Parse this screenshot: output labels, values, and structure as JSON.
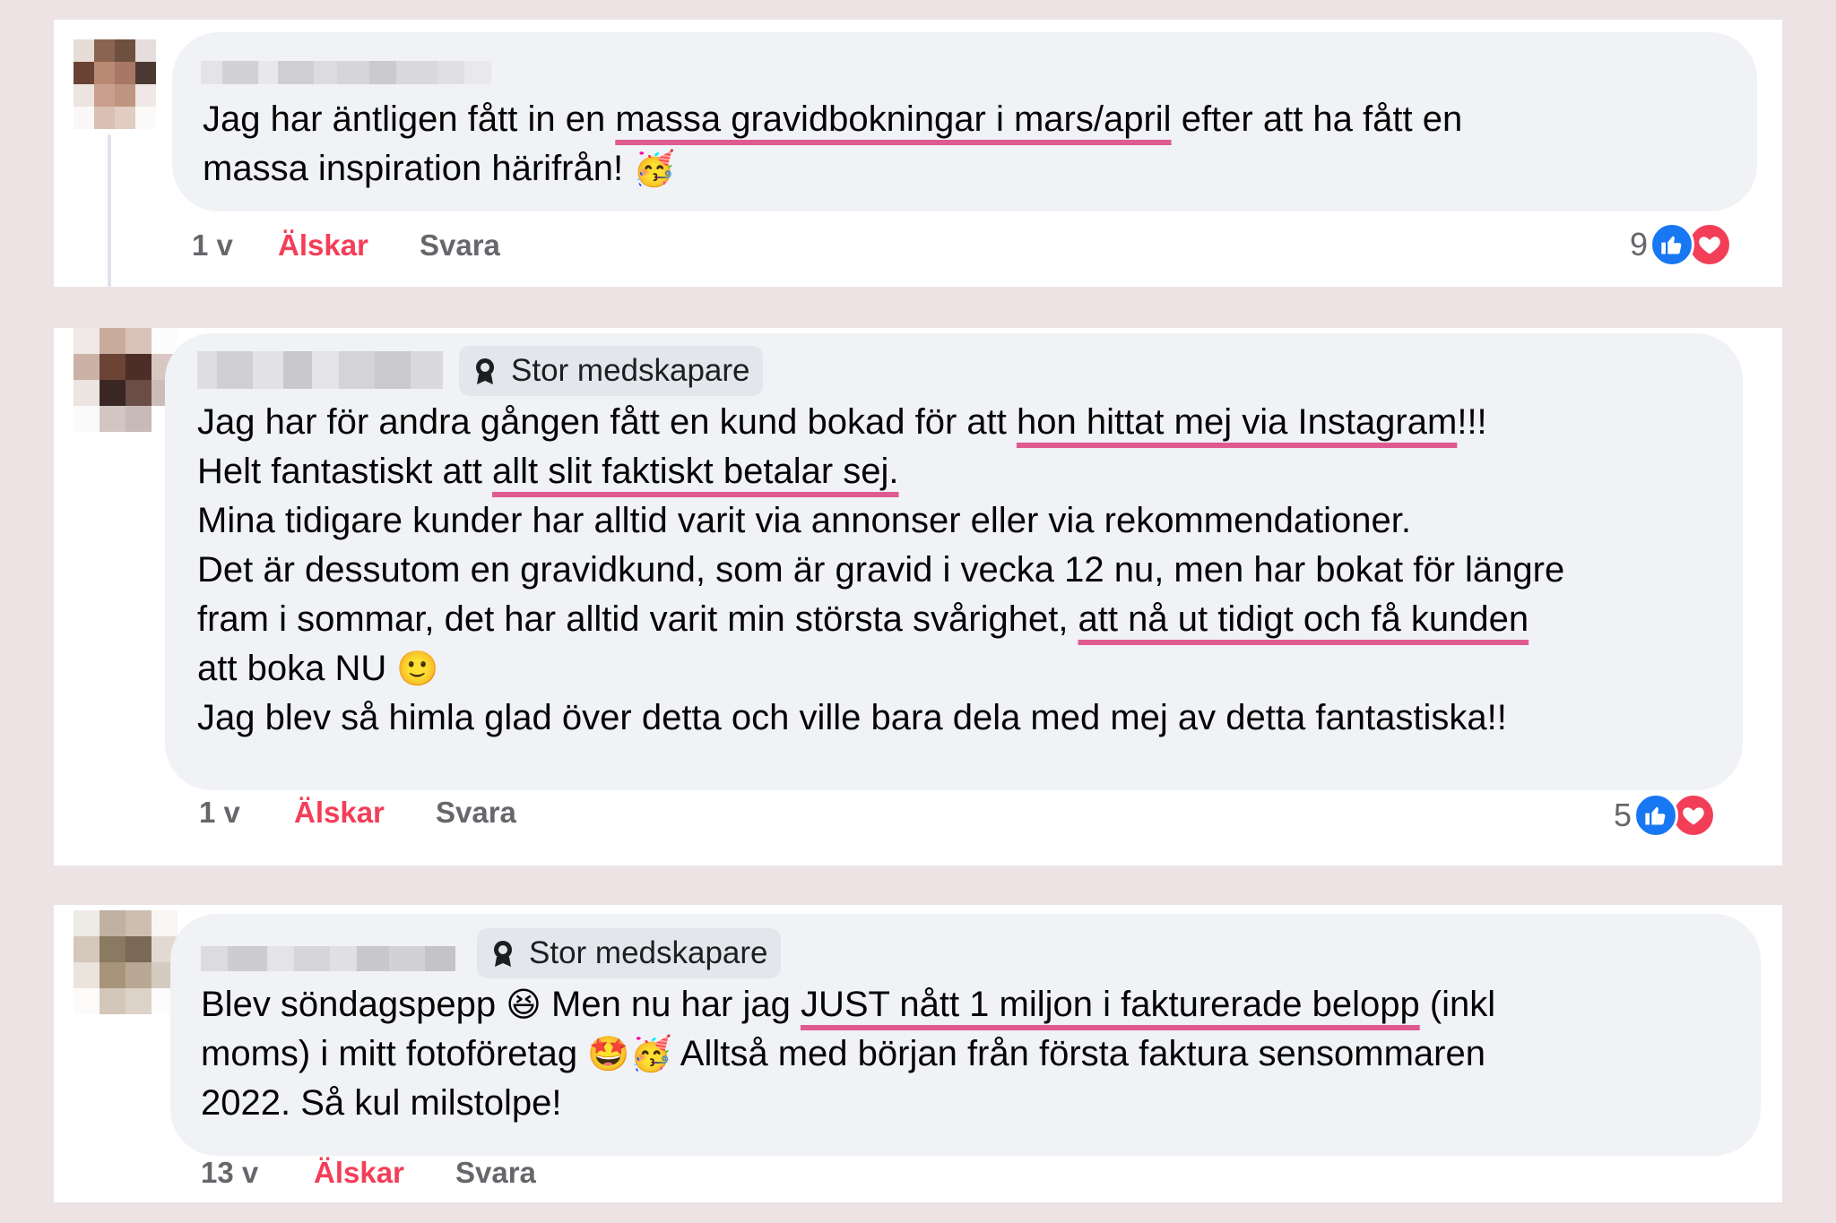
{
  "colors": {
    "page_background": "#ede3e4",
    "bubble": "#f0f2f5",
    "highlight_underline": "#df5a8f",
    "love_text": "#f33e58",
    "like_icon": "#1877f2",
    "heart_icon": "#f33e58"
  },
  "comments": [
    {
      "author_name": "",
      "badge": "",
      "paragraphs": [
        [
          {
            "text": "Jag har äntligen fått in en "
          },
          {
            "text": "massa gravidbokningar i mars/april",
            "hl": true
          },
          {
            "text": " efter att ha fått en"
          }
        ],
        [
          {
            "text": "massa inspiration härifrån! "
          },
          {
            "text": "🥳",
            "emoji": true
          }
        ]
      ],
      "time": "1 v",
      "love_label": "Älskar",
      "reply_label": "Svara",
      "reaction_count": "9",
      "reaction_icons": [
        "like-icon",
        "heart-icon"
      ]
    },
    {
      "author_name": "",
      "badge": "Stor medskapare",
      "badge_icon": "award-icon",
      "paragraphs": [
        [
          {
            "text": "Jag har för andra gången fått en kund bokad för att "
          },
          {
            "text": "hon hittat mej via Instagram",
            "hl": true
          },
          {
            "text": "!!!"
          }
        ],
        [
          {
            "text": "Helt fantastiskt att "
          },
          {
            "text": "allt slit faktiskt betalar sej.",
            "hl": true
          }
        ],
        [
          {
            "text": "Mina tidigare kunder har alltid varit via annonser eller via rekommendationer."
          }
        ],
        [
          {
            "text": "Det är dessutom en gravidkund, som är gravid i vecka 12 nu, men har bokat för längre"
          }
        ],
        [
          {
            "text": "fram i sommar, det har alltid varit min största svårighet, "
          },
          {
            "text": "att nå ut tidigt och få kunden",
            "hl": true
          }
        ],
        [
          {
            "text": "att boka NU "
          },
          {
            "text": "🙂",
            "emoji": true
          }
        ],
        [
          {
            "text": "Jag blev så himla glad över detta och ville bara dela med mej av detta fantastiska!!"
          }
        ]
      ],
      "time": "1 v",
      "love_label": "Älskar",
      "reply_label": "Svara",
      "reaction_count": "5",
      "reaction_icons": [
        "like-icon",
        "heart-icon"
      ]
    },
    {
      "author_name": "",
      "badge": "Stor medskapare",
      "badge_icon": "award-icon",
      "paragraphs": [
        [
          {
            "text": "Blev söndagspepp "
          },
          {
            "text": "😆",
            "emoji": true
          },
          {
            "text": " Men nu har jag "
          },
          {
            "text": "JUST nått 1 miljon i fakturerade belopp",
            "hl": true
          },
          {
            "text": " (inkl"
          }
        ],
        [
          {
            "text": "moms) i mitt fotoföretag "
          },
          {
            "text": "🤩🥳",
            "emoji": true
          },
          {
            "text": " Alltså med början från första faktura sensommaren"
          }
        ],
        [
          {
            "text": "2022. Så kul milstolpe!"
          }
        ]
      ],
      "time": "13 v",
      "love_label": "Älskar",
      "reply_label": "Svara",
      "reaction_count": "",
      "reaction_icons": []
    }
  ]
}
